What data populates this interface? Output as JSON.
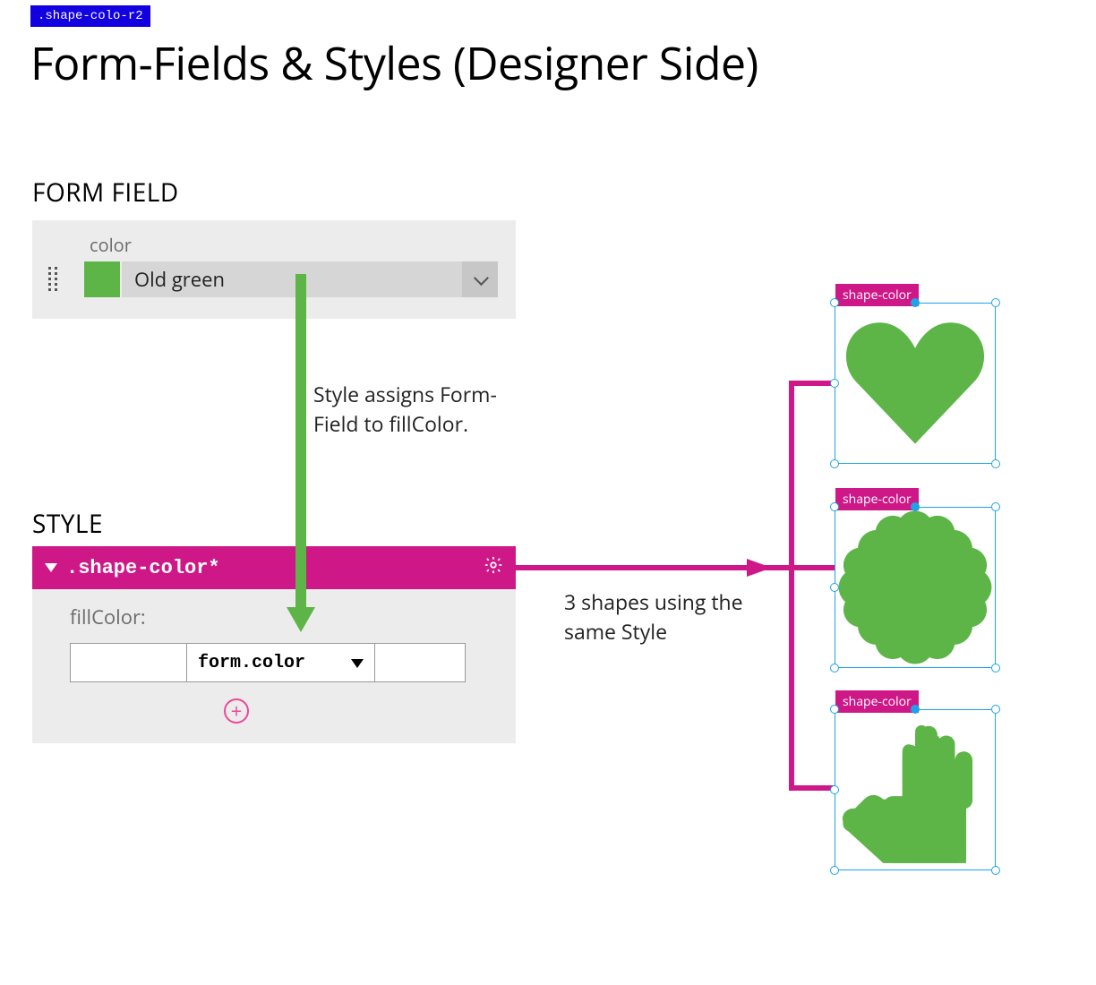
{
  "topTag": ".shape-colo-r2",
  "pageTitle": "Form-Fields & Styles (Designer Side)",
  "formFieldSection": {
    "heading": "FORM FIELD",
    "fieldLabel": "color",
    "swatchColor": "#5db548",
    "selectedValue": "Old green"
  },
  "styleSection": {
    "heading": "STYLE",
    "ruleName": ".shape-color*",
    "propertyLabel": "fillColor:",
    "bindingExpression": "form.color"
  },
  "narrative": {
    "assign": "Style assigns Form-Field to fillColor.",
    "usage": "3 shapes using the same Style"
  },
  "shapes": {
    "badgeLabel": "shape-color",
    "fill": "#5db548"
  },
  "colors": {
    "magenta": "#cf1887",
    "green": "#5db548",
    "blueTag": "#1200e0",
    "selectionBlue": "#1fa3e6"
  }
}
